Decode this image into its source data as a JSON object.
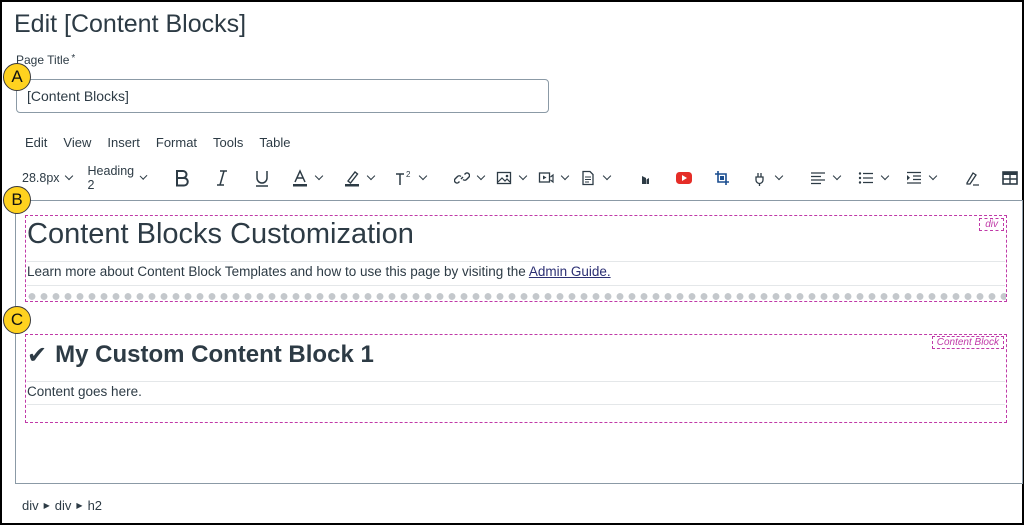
{
  "header": {
    "title": "Edit [Content Blocks]"
  },
  "form": {
    "page_title_label": "Page Title",
    "required_mark": "*",
    "page_title_value": "[Content Blocks]"
  },
  "menubar": {
    "items": [
      "Edit",
      "View",
      "Insert",
      "Format",
      "Tools",
      "Table"
    ]
  },
  "toolbar": {
    "font_size": "28.8px",
    "block_format": "Heading 2",
    "icons": [
      "bold-icon",
      "italic-icon",
      "underline-icon",
      "text-color-icon",
      "highlight-icon",
      "superscript-icon",
      "link-icon",
      "image-icon",
      "media-icon",
      "document-icon",
      "apps-icon",
      "youtube-icon",
      "crop-icon",
      "plugin-icon",
      "align-icon",
      "bullet-list-icon",
      "indent-icon",
      "clear-format-icon",
      "table-icon"
    ]
  },
  "editor": {
    "block_b": {
      "tag": "div",
      "heading": "Content Blocks Customization",
      "text": "Learn more about Content Block Templates and how to use this page by visiting the ",
      "link": "Admin Guide."
    },
    "block_c": {
      "tag": "Content Block",
      "heading": "My Custom Content Block 1",
      "text": "Content goes here."
    }
  },
  "markers": [
    "A",
    "B",
    "C"
  ],
  "statusbar": {
    "path": [
      "div",
      "div",
      "h2"
    ]
  },
  "colors": {
    "accent_marker": "#ffd21f",
    "block_outline": "#c03aa8",
    "link": "#2b2f73",
    "text": "#2d3b45"
  }
}
